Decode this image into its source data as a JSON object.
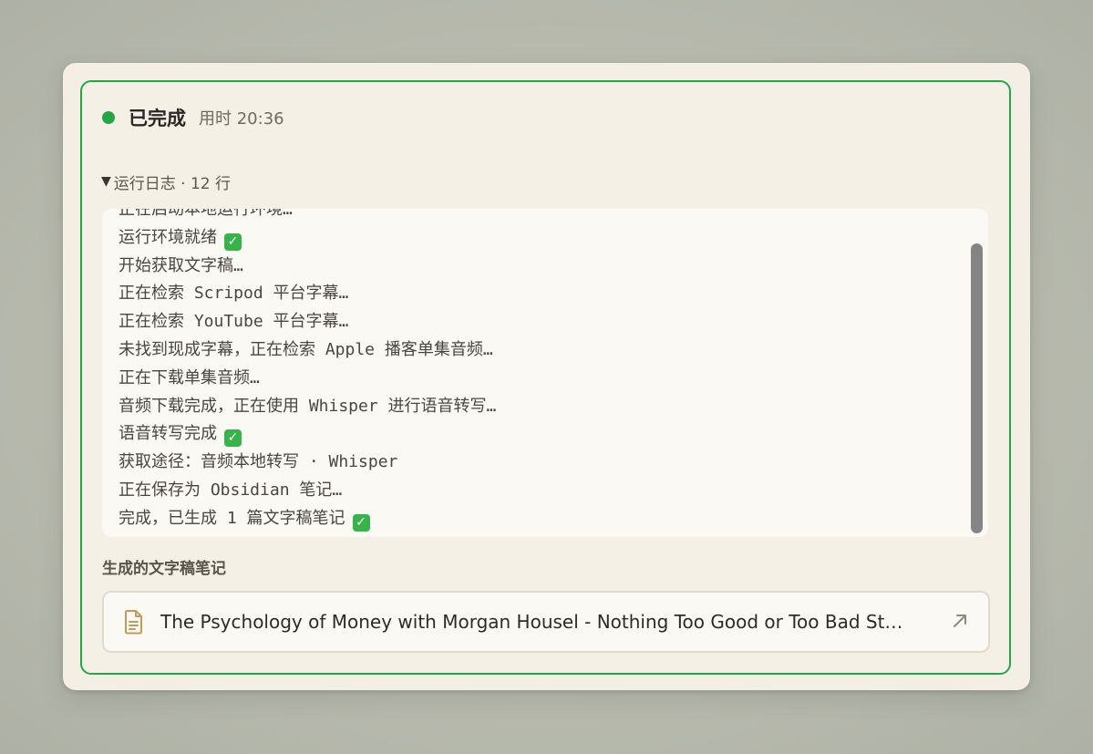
{
  "status": {
    "label": "已完成",
    "elapsed": "用时 20:36",
    "color": "#22a646"
  },
  "log": {
    "toggle_label": "运行日志 · 12 行",
    "lines": [
      "正在启动本地运行环境…",
      "运行环境就绪",
      "开始获取文字稿…",
      "正在检索 Scripod 平台字幕…",
      "正在检索 YouTube 平台字幕…",
      "未找到现成字幕，正在检索 Apple 播客单集音频…",
      "正在下载单集音频…",
      "音频下载完成，正在使用 Whisper 进行语音转写…",
      "语音转写完成",
      "获取途径：音频本地转写 · Whisper",
      "正在保存为 Obsidian 笔记…",
      "完成，已生成 1 篇文字稿笔记"
    ],
    "check_mark": "✓",
    "check_lines": [
      1,
      8,
      11
    ]
  },
  "notes": {
    "heading": "生成的文字稿笔记",
    "items": [
      {
        "title": "The Psychology of Money with Morgan Housel - Nothing Too Good or Too Bad St…",
        "icon": "document-icon",
        "action_icon": "open-external-icon"
      }
    ]
  },
  "colors": {
    "accent": "#22a646",
    "doc_icon": "#c49a5a"
  }
}
